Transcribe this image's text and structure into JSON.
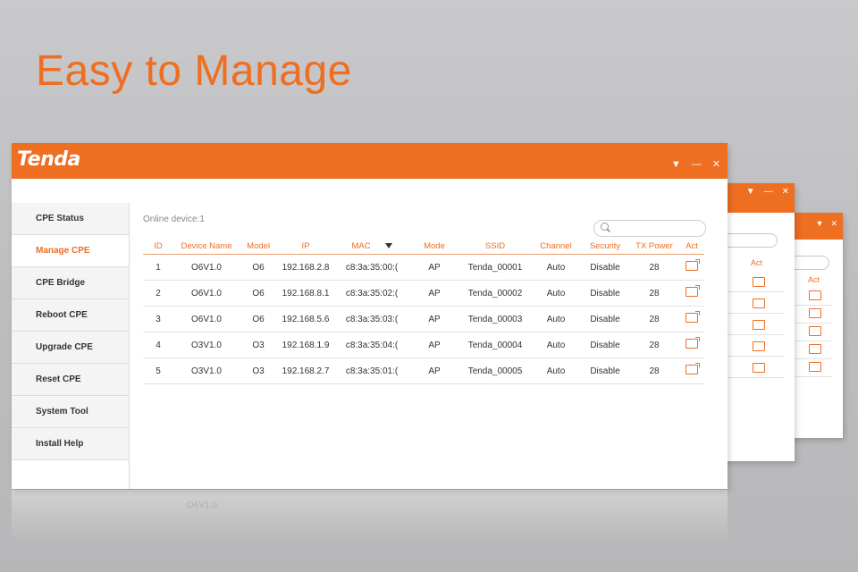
{
  "headline": "Easy to Manage",
  "app": {
    "logo": "Tenda",
    "window_controls": [
      "minimize-icon",
      "close-icon"
    ],
    "accent_color": "#ee6e22"
  },
  "sidebar": {
    "items": [
      {
        "label": "CPE Status",
        "active": false
      },
      {
        "label": "Manage CPE",
        "active": true
      },
      {
        "label": "CPE Bridge",
        "active": false
      },
      {
        "label": "Reboot CPE",
        "active": false
      },
      {
        "label": "Upgrade CPE",
        "active": false
      },
      {
        "label": "Reset CPE",
        "active": false
      },
      {
        "label": "System Tool",
        "active": false
      },
      {
        "label": "Install Help",
        "active": false
      }
    ]
  },
  "main": {
    "online_label": "Online device:1",
    "search": {
      "placeholder": "",
      "icon": "search-icon"
    },
    "table": {
      "columns": [
        "ID",
        "Device Name",
        "Model",
        "IP",
        "MAC",
        "Mode",
        "SSID",
        "Channel",
        "Security",
        "TX Power",
        "Act"
      ],
      "rows": [
        [
          "1",
          "O6V1.0",
          "O6",
          "192.168.2.8",
          "c8:3a:35:00:(",
          "AP",
          "Tenda_00001",
          "Auto",
          "Disable",
          "28",
          ""
        ],
        [
          "2",
          "O6V1.0",
          "O6",
          "192.168.8.1",
          "c8:3a:35:02:(",
          "AP",
          "Tenda_00002",
          "Auto",
          "Disable",
          "28",
          ""
        ],
        [
          "3",
          "O6V1.0",
          "O6",
          "192.168.5.6",
          "c8:3a:35:03:(",
          "AP",
          "Tenda_00003",
          "Auto",
          "Disable",
          "28",
          ""
        ],
        [
          "4",
          "O3V1.0",
          "O3",
          "192.168.1.9",
          "c8:3a:35:04:(",
          "AP",
          "Tenda_00004",
          "Auto",
          "Disable",
          "28",
          ""
        ],
        [
          "5",
          "O3V1.0",
          "O3",
          "192.168.2.7",
          "c8:3a:35:01:(",
          "AP",
          "Tenda_00005",
          "Auto",
          "Disable",
          "28",
          ""
        ]
      ]
    }
  },
  "back_windows": {
    "win2_act_label": "Act",
    "win3_act_label": "Act"
  },
  "reflection": {
    "labels": [
      "O6V1.0"
    ]
  }
}
